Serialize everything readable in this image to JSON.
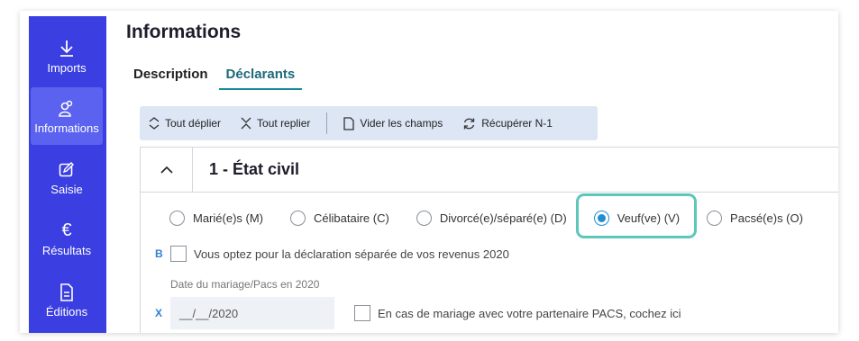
{
  "sidebar": {
    "items": [
      {
        "label": "Imports",
        "icon": "download-icon",
        "active": false
      },
      {
        "label": "Informations",
        "icon": "people-icon",
        "active": true
      },
      {
        "label": "Saisie",
        "icon": "edit-icon",
        "active": false
      },
      {
        "label": "Résultats",
        "icon": "euro-icon",
        "active": false
      },
      {
        "label": "Éditions",
        "icon": "document-icon",
        "active": false
      }
    ]
  },
  "header": {
    "title": "Informations",
    "tabs": [
      {
        "label": "Description",
        "active": false
      },
      {
        "label": "Déclarants",
        "active": true
      }
    ]
  },
  "toolbar": {
    "expand_all": "Tout déplier",
    "collapse_all": "Tout replier",
    "clear_fields": "Vider les champs",
    "retrieve_prev": "Récupérer N-1"
  },
  "section": {
    "title": "1 - État civil",
    "marital_status": {
      "options": [
        "Marié(e)s (M)",
        "Célibataire (C)",
        "Divorcé(e)/séparé(e) (D)",
        "Veuf(ve) (V)",
        "Pacsé(e)s (O)"
      ],
      "selected": "Veuf(ve) (V)"
    },
    "separate_declaration": {
      "code": "B",
      "label": "Vous optez pour la déclaration séparée de vos revenus 2020"
    },
    "date_label": "Date du mariage/Pacs en 2020",
    "date_field": {
      "code": "X",
      "value": "__/__/2020"
    },
    "pacs_partner": {
      "label": "En cas de mariage avec votre partenaire PACS, cochez ici"
    }
  },
  "colors": {
    "sidebar": "#3b3ee0",
    "sidebar_active": "#5b62ef",
    "accent": "#1d8a9a",
    "radio_checked": "#1f8fd0",
    "highlight": "#5dc7ba"
  }
}
